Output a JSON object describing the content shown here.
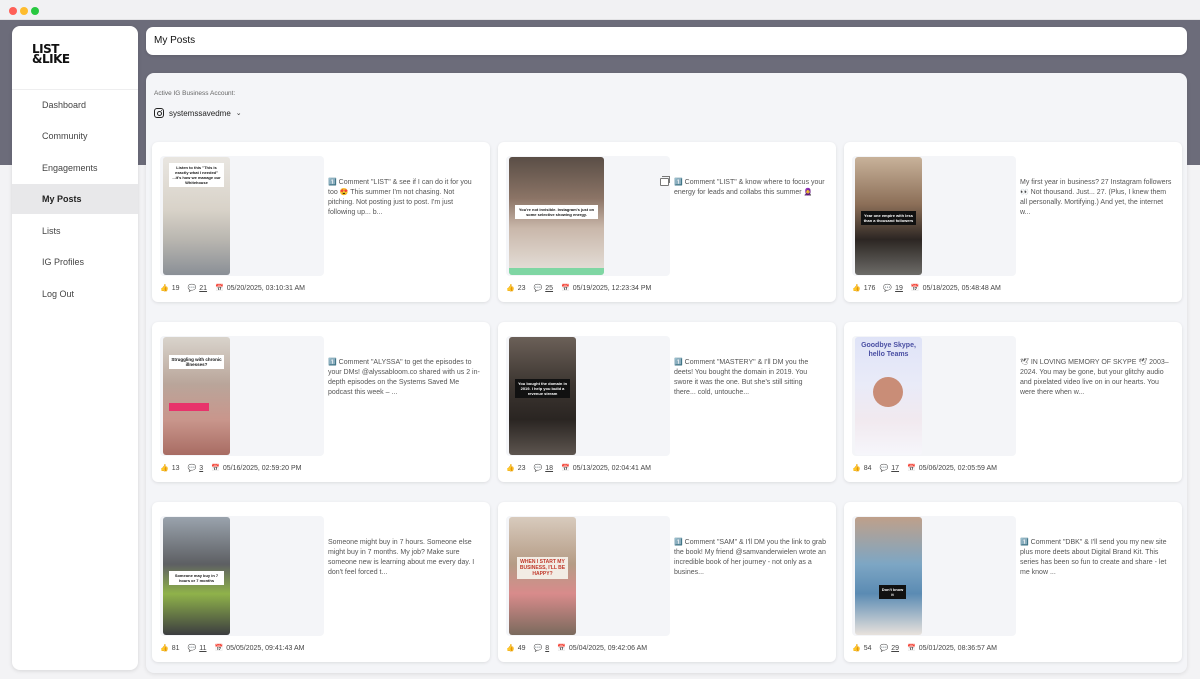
{
  "sidebar": {
    "logo_line1": "LIST",
    "logo_line2": "&LIKE",
    "items": [
      {
        "label": "Dashboard"
      },
      {
        "label": "Community"
      },
      {
        "label": "Engagements"
      },
      {
        "label": "My Posts",
        "active": true
      },
      {
        "label": "Lists"
      },
      {
        "label": "IG Profiles"
      },
      {
        "label": "Log Out"
      }
    ]
  },
  "header": {
    "title": "My Posts"
  },
  "account": {
    "label": "Active IG Business Account:",
    "handle": "systemssavedme"
  },
  "colors": {
    "accent_band": "#6c6c7a",
    "active_nav_bg": "#e8e8ea"
  },
  "posts": [
    {
      "caption": "1️⃣ Comment \"LIST\" & see if I can do it for you too 😍 This summer I'm not chasing. Not pitching. Not posting just to post. I'm just following up... b...",
      "likes": "19",
      "comments": "21",
      "date": "05/20/2025, 03:10:31 AM",
      "overlay": "Listen to this \"This is exactly what I needed\" ...it's how we manage our Whitehouse"
    },
    {
      "caption": "1️⃣ Comment \"LIST\" & know where to focus your energy for leads and collabs this summer 🧕",
      "likes": "23",
      "comments": "25",
      "date": "05/19/2025, 12:23:34 PM",
      "overlay": "You're not invisible. Instagram's just on some selective showing energy."
    },
    {
      "caption": "My first year in business? 27 Instagram followers 👀 Not thousand. Just... 27. (Plus, I knew them all personally. Mortifying.) And yet, the internet w...",
      "likes": "176",
      "comments": "19",
      "date": "05/18/2025, 05:48:48 AM",
      "overlay": "Year one empire with less than a thousand followers"
    },
    {
      "caption": "1️⃣ Comment \"ALYSSA\" to get the episodes to your DMs! @alyssabloom.co shared with us 2 in-depth episodes on the Systems Saved Me podcast this week – ...",
      "likes": "13",
      "comments": "3",
      "date": "05/16/2025, 02:59:20 PM",
      "overlay": "Struggling with chronic illnesses?"
    },
    {
      "caption": "1️⃣ Comment \"MASTERY\" & I'll DM you the deets! You bought the domain in 2019. You swore it was the one. But she's still sitting there... cold, untouche...",
      "likes": "23",
      "comments": "18",
      "date": "05/13/2025, 02:04:41 AM",
      "overlay": "You bought the domain in 2019. I help you build a revenue stream"
    },
    {
      "caption": "🕊 IN LOVING MEMORY OF SKYPE 🕊 2003–2024. You may be gone, but your glitchy audio and pixelated video live on in our hearts. You were there when w...",
      "likes": "84",
      "comments": "17",
      "date": "05/06/2025, 02:05:59 AM",
      "overlay": "Goodbye Skype, hello Teams"
    },
    {
      "caption": "Someone might buy in 7 hours. Someone else might buy in 7 months. My job? Make sure someone new is learning about me every day. I don't feel forced t...",
      "likes": "81",
      "comments": "11",
      "date": "05/05/2025, 09:41:43 AM",
      "overlay": "Someone may buy in 7 hours or 7 months"
    },
    {
      "caption": "1️⃣ Comment \"SAM\" & I'll DM you the link to grab the book! My friend @samvanderwielen wrote an incredible book of her journey - not only as a busines...",
      "likes": "49",
      "comments": "8",
      "date": "05/04/2025, 09:42:06 AM",
      "overlay": "WHEN I START MY BUSINESS, I'LL BE HAPPY?"
    },
    {
      "caption": "1️⃣ Comment \"DBK\" & I'll send you my new site plus more deets about Digital Brand Kit. This series has been so fun to create and share - let me know ...",
      "likes": "54",
      "comments": "29",
      "date": "05/01/2025, 08:36:57 AM",
      "overlay": "Don't know it"
    }
  ]
}
